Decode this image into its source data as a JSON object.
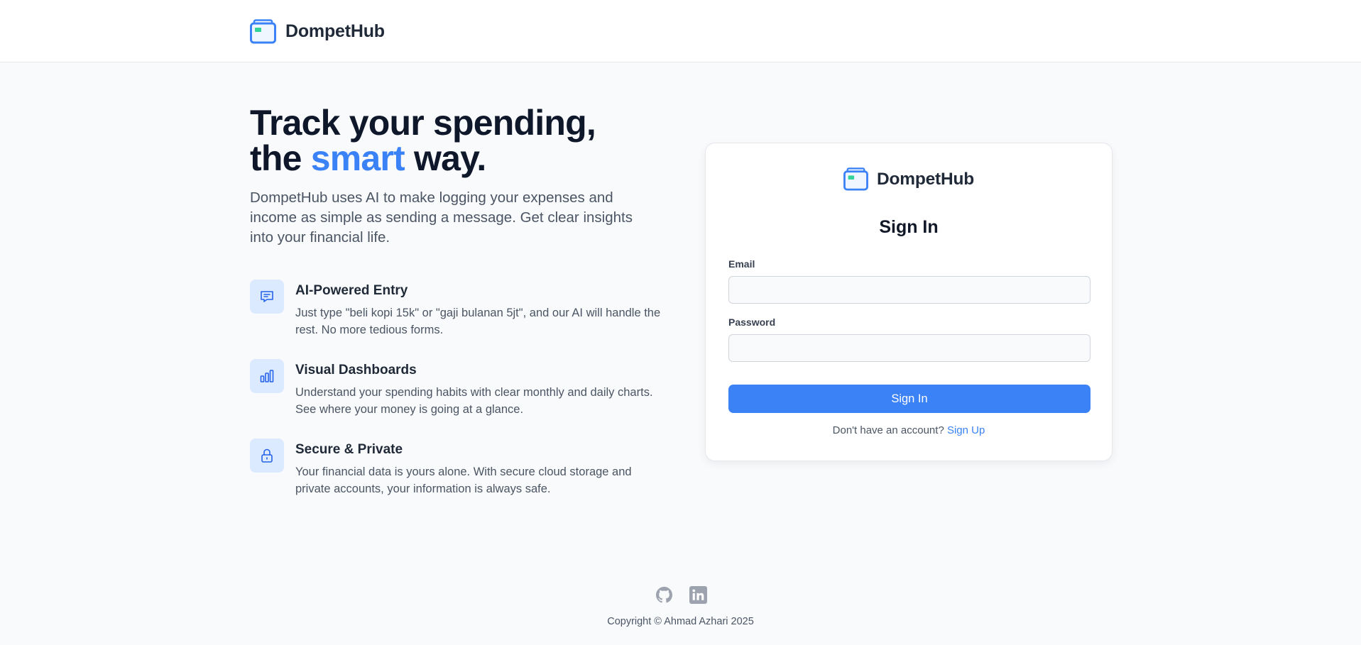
{
  "brand": {
    "name": "DompetHub"
  },
  "hero": {
    "headline_line1": "Track your spending,",
    "headline_pre": "the ",
    "headline_accent": "smart",
    "headline_post": " way.",
    "lead": "DompetHub uses AI to make logging your expenses and income as simple as sending a message. Get clear insights into your financial life."
  },
  "features": [
    {
      "icon": "chat-icon",
      "title": "AI-Powered Entry",
      "desc": "Just type \"beli kopi 15k\" or \"gaji bulanan 5jt\", and our AI will handle the rest. No more tedious forms."
    },
    {
      "icon": "bar-chart-icon",
      "title": "Visual Dashboards",
      "desc": "Understand your spending habits with clear monthly and daily charts. See where your money is going at a glance."
    },
    {
      "icon": "lock-icon",
      "title": "Secure & Private",
      "desc": "Your financial data is yours alone. With secure cloud storage and private accounts, your information is always safe."
    }
  ],
  "login": {
    "brand": "DompetHub",
    "title": "Sign In",
    "email_label": "Email",
    "email_value": "",
    "password_label": "Password",
    "password_value": "",
    "submit_label": "Sign In",
    "signup_prompt": "Don't have an account?",
    "signup_link": "Sign Up"
  },
  "footer": {
    "social_icons": [
      "github-icon",
      "linkedin-icon"
    ],
    "copyright": "Copyright © Ahmad Azhari 2025"
  },
  "colors": {
    "accent": "#3b82f6",
    "icon_bg": "#dbeafe",
    "page_bg": "#f8fafc",
    "wallet_green": "#34d399"
  }
}
